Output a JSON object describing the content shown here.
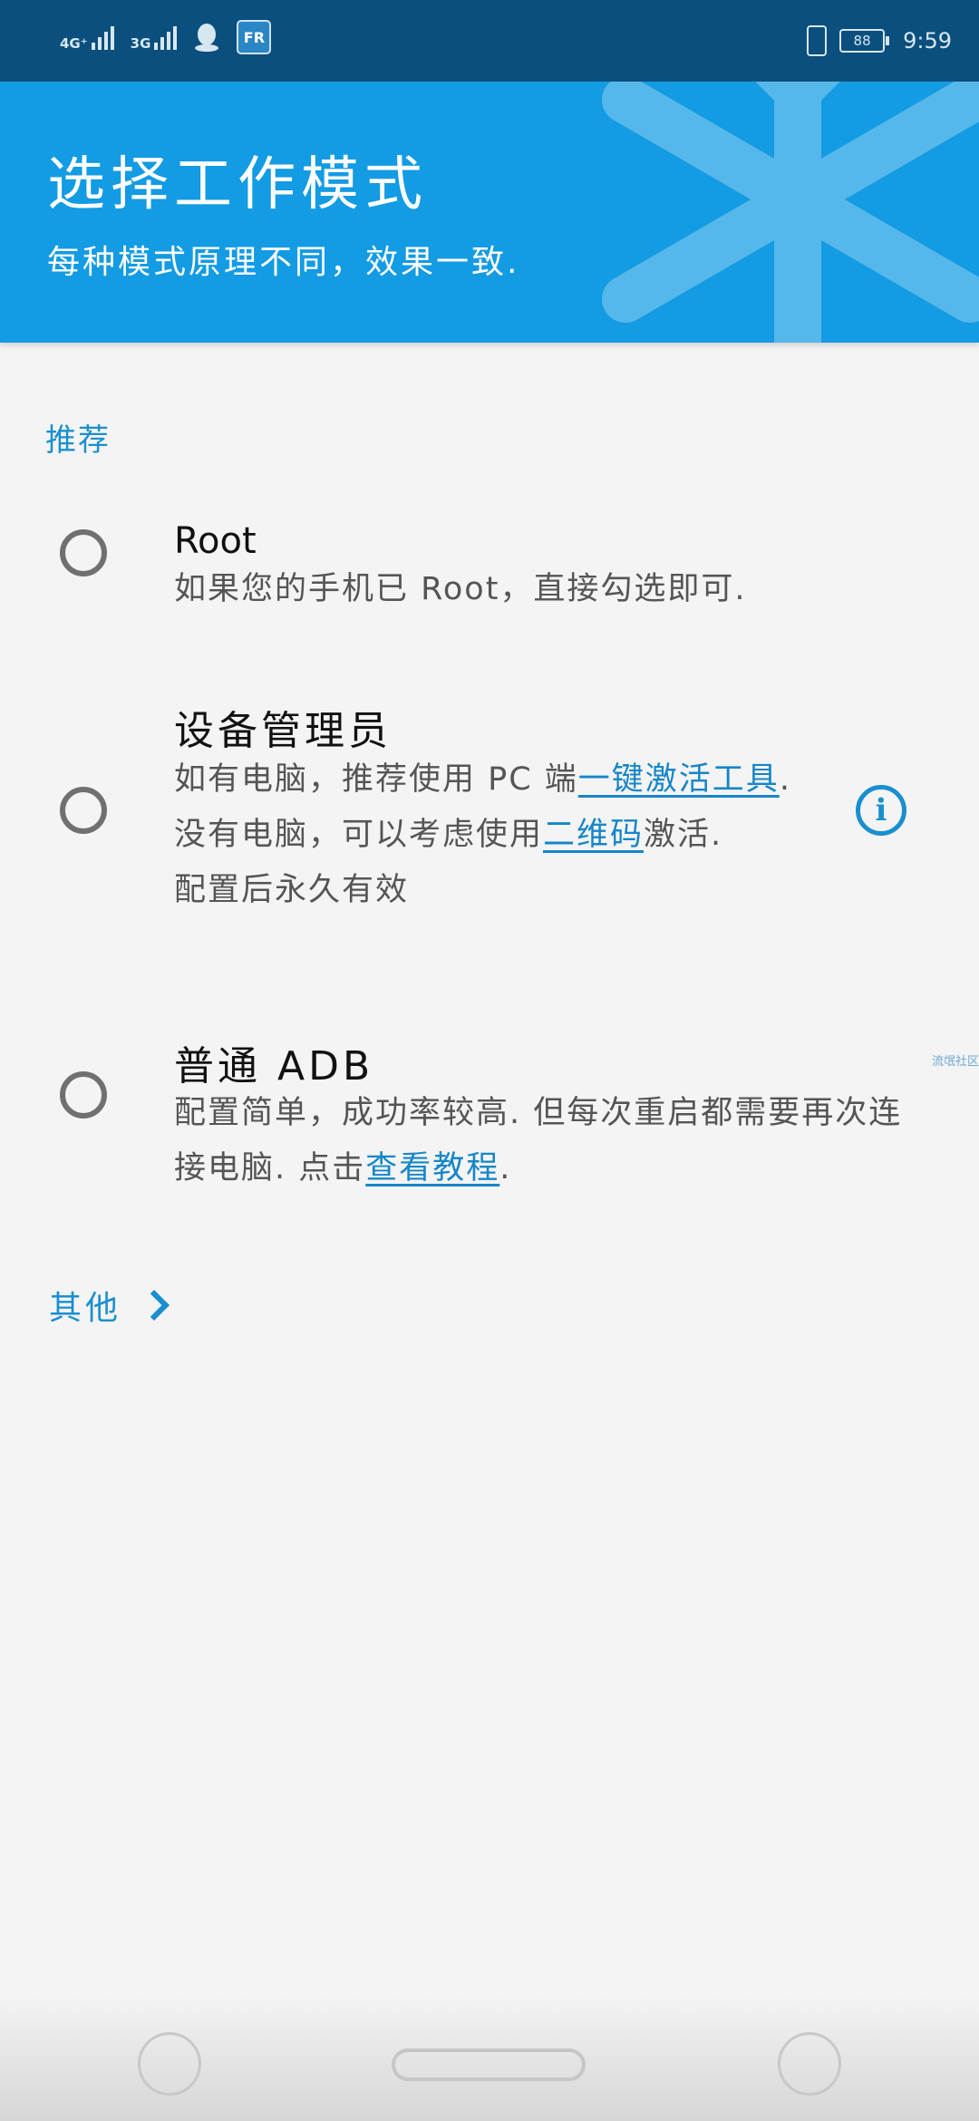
{
  "status_bar": {
    "net1": "4G⁺",
    "net2": "3G",
    "app_badge": "FR",
    "battery": "88",
    "time": "9:59"
  },
  "header": {
    "title": "选择工作模式",
    "subtitle": "每种模式原理不同，效果一致."
  },
  "section": {
    "recommended": "推荐"
  },
  "options": [
    {
      "title": "Root",
      "desc": "如果您的手机已 Root，直接勾选即可."
    },
    {
      "title": "设备管理员",
      "line1_text": "如有电脑，推荐使用 PC 端",
      "line1_link": "一键激活工具",
      "line1_end": ".",
      "line2_text": "没有电脑，可以考虑使用",
      "line2_link": "二维码",
      "line2_end": "激活.",
      "line3": "配置后永久有效"
    },
    {
      "title": "普通 ADB",
      "text": "配置简单，成功率较高. 但每次重启都需要再次连接电脑. 点击",
      "link": "查看教程",
      "end": "."
    }
  ],
  "other_label": "其他",
  "watermark": "流氓社区",
  "colors": {
    "accent": "#139be3",
    "link": "#1686c8",
    "status_bar": "#0a4f7d"
  },
  "icons": [
    "signal-icon",
    "qq-icon",
    "vibrate-icon",
    "battery-icon",
    "info-icon",
    "chevron-right-icon"
  ]
}
